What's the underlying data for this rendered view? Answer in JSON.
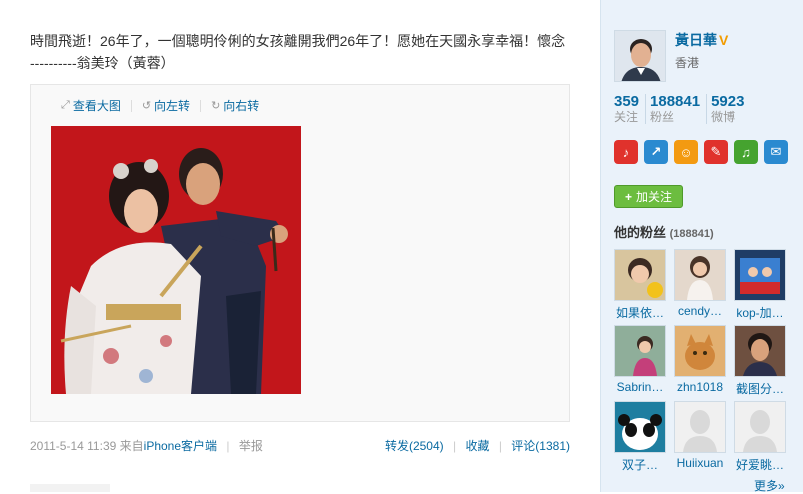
{
  "post": {
    "text_line1": "時間飛逝！26年了，一個聰明伶俐的女孩離開我們26年了！愿她在天國永享幸福！懷念",
    "text_line2": "----------翁美玲（黃蓉）"
  },
  "media": {
    "tools": [
      {
        "icon": "zoom-icon",
        "label": "查看大图"
      },
      {
        "icon": "rotate-left-icon",
        "label": "向左转"
      },
      {
        "icon": "rotate-right-icon",
        "label": "向右转"
      }
    ]
  },
  "meta": {
    "time": "2011-5-14 11:39",
    "from_prefix": "来自",
    "source": "iPhone客户端",
    "report": "举报",
    "repost": "转发(2504)",
    "favorite": "收藏",
    "comment": "评论(1381)"
  },
  "profile": {
    "name": "黃日華",
    "verified_mark": "V",
    "location": "香港",
    "stats": [
      {
        "num": "359",
        "label": "关注"
      },
      {
        "num": "188841",
        "label": "粉丝"
      },
      {
        "num": "5923",
        "label": "微博"
      }
    ],
    "apps": [
      {
        "icon": "microphone-icon",
        "glyph": "🎤",
        "color": "#e0322c"
      },
      {
        "icon": "share-icon",
        "glyph": "↗",
        "color": "#2a8ad0"
      },
      {
        "icon": "smile-icon",
        "glyph": "☺",
        "color": "#f39a11"
      },
      {
        "icon": "tag-icon",
        "glyph": "✎",
        "color": "#e0322c"
      },
      {
        "icon": "music-icon",
        "glyph": "♫",
        "color": "#45a32f"
      },
      {
        "icon": "chat-icon",
        "glyph": "✉",
        "color": "#2a8ad0"
      }
    ],
    "follow_label": "加关注",
    "fans_title": "他的粉丝",
    "fans_count": "(188841)",
    "fans": [
      {
        "name": "如果依…",
        "bg": "#d8c59e"
      },
      {
        "name": "cendy…",
        "bg": "#d9c8b8"
      },
      {
        "name": "kop-加…",
        "bg": "#355a8a"
      },
      {
        "name": "Sabrin…",
        "bg": "#c8a3b4"
      },
      {
        "name": "zhn1018",
        "bg": "#d89a52"
      },
      {
        "name": "截图分…",
        "bg": "#7a5a4a"
      },
      {
        "name": "双子…",
        "bg": "#1e7ea0"
      },
      {
        "name": "Huiixuan",
        "bg": "#f1f1f1"
      },
      {
        "name": "好爱眺…",
        "bg": "#f1f1f1"
      }
    ],
    "more": "更多»"
  }
}
